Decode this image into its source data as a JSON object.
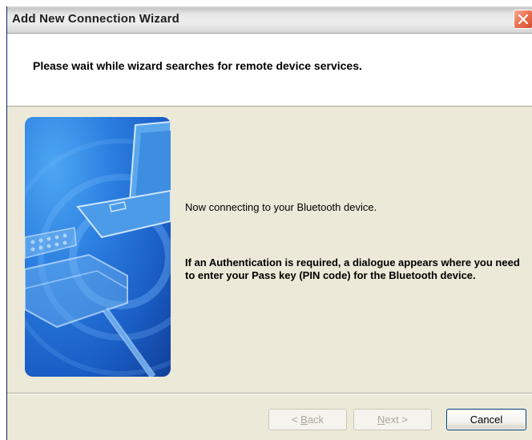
{
  "window": {
    "title": "Add New Connection Wizard"
  },
  "header": {
    "instruction": "Please wait while wizard searches for remote device services."
  },
  "main": {
    "status_text": "Now connecting to your Bluetooth device.",
    "auth_text": "If an Authentication is required, a dialogue appears where you need to enter your Pass key (PIN code) for the Bluetooth device."
  },
  "buttons": {
    "back_mnemonic": "B",
    "back_rest": "ack",
    "back_prefix": "< ",
    "next_mnemonic": "N",
    "next_rest": "ext >",
    "cancel": "Cancel"
  },
  "icons": {
    "close": "close-icon",
    "illustration": "laptop-illustration"
  },
  "colors": {
    "dialog_bg": "#ece9d8",
    "header_bg": "#ffffff",
    "illustration_blue": "#2b7fe0",
    "close_button": "#e96f52",
    "disabled_text": "#aca899"
  }
}
